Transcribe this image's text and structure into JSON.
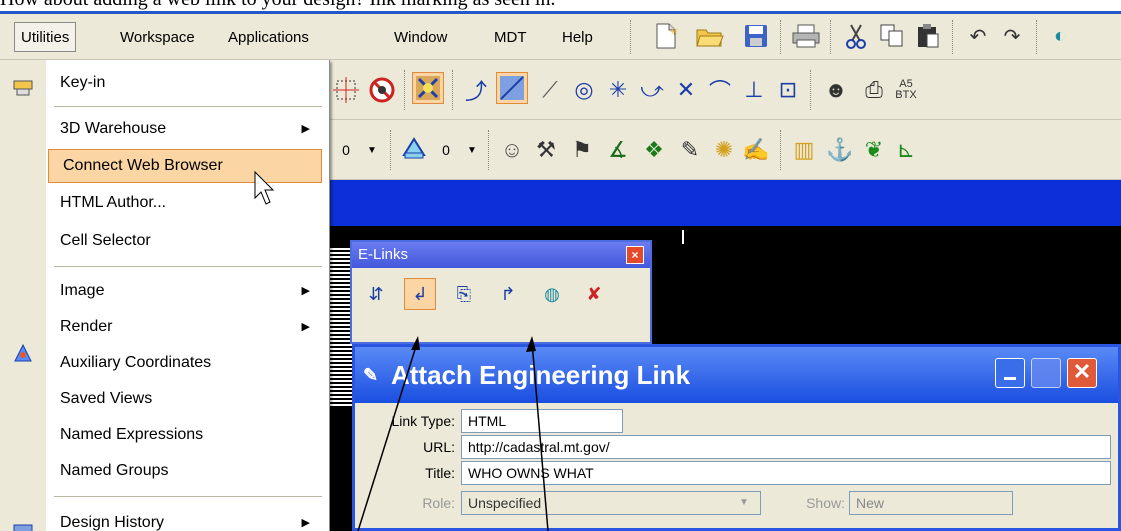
{
  "caption": "How about adding a web link to your design? Ink marking as seen in.",
  "menubar": {
    "items": [
      "Utilities",
      "Workspace",
      "Applications",
      "Window",
      "MDT",
      "Help"
    ]
  },
  "dropdown": {
    "items": [
      {
        "label": "Key-in",
        "has_submenu": false
      },
      {
        "label": "3D Warehouse",
        "has_submenu": true
      },
      {
        "label": "Connect Web Browser",
        "has_submenu": false
      },
      {
        "label": "HTML Author...",
        "has_submenu": false
      },
      {
        "label": "Cell Selector",
        "has_submenu": false
      },
      {
        "label": "Image",
        "has_submenu": true
      },
      {
        "label": "Render",
        "has_submenu": true
      },
      {
        "label": "Auxiliary Coordinates",
        "has_submenu": false
      },
      {
        "label": "Saved Views",
        "has_submenu": false
      },
      {
        "label": "Named Expressions",
        "has_submenu": false
      },
      {
        "label": "Named Groups",
        "has_submenu": false
      },
      {
        "label": "Design History",
        "has_submenu": true
      }
    ],
    "highlighted": "Connect Web Browser",
    "arrow_glyph": "▶"
  },
  "toolbar": {
    "level_value_1": "0",
    "level_value_2": "0",
    "a5_label": "A5\nBTX"
  },
  "elinks": {
    "title": "E-Links",
    "close": "×"
  },
  "dialog": {
    "title": "Attach Engineering Link",
    "fields": {
      "link_type_label": "Link Type:",
      "link_type_value": "HTML",
      "url_label": "URL:",
      "url_value": "http://cadastral.mt.gov/",
      "title_label": "Title:",
      "title_value": "WHO OWNS WHAT",
      "role_label": "Role:",
      "role_value": "Unspecified",
      "show_label": "Show:",
      "show_value": "New"
    }
  },
  "colors": {
    "menu_bg": "#ece9d8",
    "highlight": "#fbd6a4",
    "title_blue": "#2a55e0"
  }
}
